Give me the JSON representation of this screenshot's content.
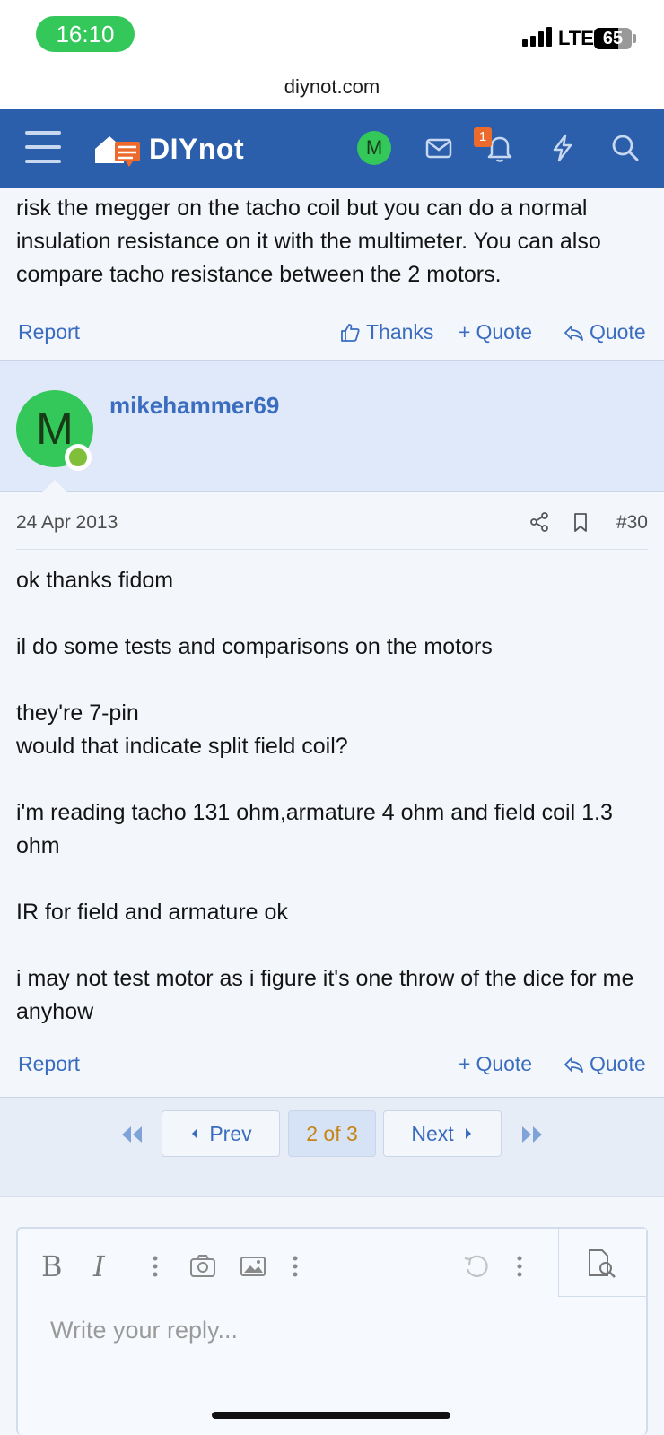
{
  "status_bar": {
    "time": "16:10",
    "network": "LTE",
    "battery": "65",
    "battery_level": 0.65
  },
  "browser": {
    "url": "diynot.com"
  },
  "header": {
    "logo_text": "DIYnot",
    "avatar_letter": "M",
    "notification_count": "1",
    "icons": [
      "menu-icon",
      "logo-house-icon",
      "mail-icon",
      "bell-icon",
      "lightning-icon",
      "search-icon"
    ]
  },
  "previous_post": {
    "text": "risk the megger on the tacho coil but you can do a normal insulation resistance on it with the multimeter. You can also compare tacho resistance between the 2 motors.",
    "actions": {
      "report": "Report",
      "thanks": "Thanks",
      "multi_quote": "Quote",
      "quote": "Quote"
    }
  },
  "post": {
    "username": "mikehammer69",
    "avatar_letter": "M",
    "date": "24 Apr 2013",
    "number": "#30",
    "paragraphs": [
      "ok thanks fidom",
      "il do some tests and comparisons on the motors",
      "they're 7-pin\nwould that indicate split field coil?",
      "i'm reading tacho 131 ohm,armature 4 ohm and field coil 1.3 ohm",
      "IR for field and armature ok",
      "i may not test motor as i figure it's one throw of the dice for me anyhow"
    ],
    "actions": {
      "report": "Report",
      "multi_quote": "Quote",
      "quote": "Quote"
    }
  },
  "pagination": {
    "prev": "Prev",
    "current": "2 of 3",
    "next": "Next"
  },
  "editor": {
    "placeholder": "Write your reply...",
    "bold": "B",
    "italic": "I"
  },
  "colors": {
    "header_bg": "#2b5fab",
    "link": "#3a6cc0",
    "avatar_green": "#34c759",
    "badge_orange": "#ec6a2b"
  }
}
